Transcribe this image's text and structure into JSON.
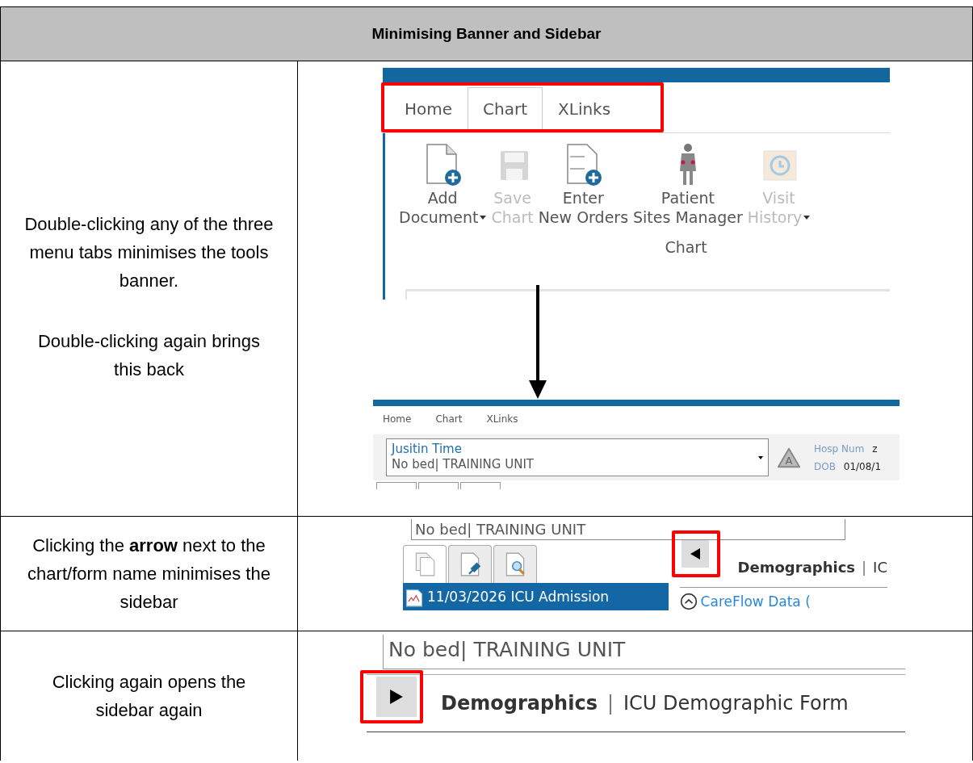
{
  "title": "Minimising Banner and Sidebar",
  "banner_row": {
    "instructions": [
      "Double-clicking any of the three menu tabs minimises the tools banner.",
      "Double-clicking again brings this back"
    ],
    "ribbon": {
      "tabs": [
        {
          "label": "Home",
          "selected": false
        },
        {
          "label": "Chart",
          "selected": true
        },
        {
          "label": "XLinks",
          "selected": false
        }
      ],
      "tools": [
        {
          "kind": "add-document",
          "lines": [
            "Add",
            "Document"
          ],
          "disabled": false,
          "dropdown": true
        },
        {
          "kind": "save",
          "lines": [
            "Save",
            "Chart"
          ],
          "disabled": true,
          "dropdown": false
        },
        {
          "kind": "orders",
          "lines": [
            "Enter",
            "New Orders"
          ],
          "disabled": false,
          "dropdown": false
        },
        {
          "kind": "person",
          "lines": [
            "Patient",
            "Sites Manager"
          ],
          "disabled": false,
          "dropdown": false
        },
        {
          "kind": "history",
          "lines": [
            "Visit",
            "History"
          ],
          "disabled": true,
          "dropdown": true
        }
      ],
      "group_label": "Chart"
    },
    "minimised": {
      "tabs": [
        "Home",
        "Chart",
        "XLinks"
      ],
      "patient_name": "Jusitin Time",
      "location": "No bed| TRAINING UNIT",
      "hosp_num_label": "Hosp Num",
      "hosp_num_value": "z",
      "alert_letter": "A",
      "dob_label": "DOB",
      "dob_value": "01/08/1"
    }
  },
  "sidebar_close_row": {
    "instruction": "Clicking the **arrow** next to the chart/form name minimises the sidebar",
    "location": "No bed| TRAINING UNIT",
    "sidebar_tabs": [
      {
        "kind": "documents",
        "selected": true
      },
      {
        "kind": "pinned",
        "selected": false
      },
      {
        "kind": "search",
        "selected": false
      }
    ],
    "list_item": {
      "label": "11/03/2026 ICU Admission",
      "selected": true
    },
    "form_name": "Demographics",
    "separator": "|",
    "form_title": "IC",
    "link": "CareFlow Data ("
  },
  "sidebar_open_row": {
    "instruction": "Clicking again opens the sidebar again",
    "location": "No bed| TRAINING UNIT",
    "form_name": "Demographics",
    "separator": "|",
    "form_title": "ICU Demographic Form"
  }
}
